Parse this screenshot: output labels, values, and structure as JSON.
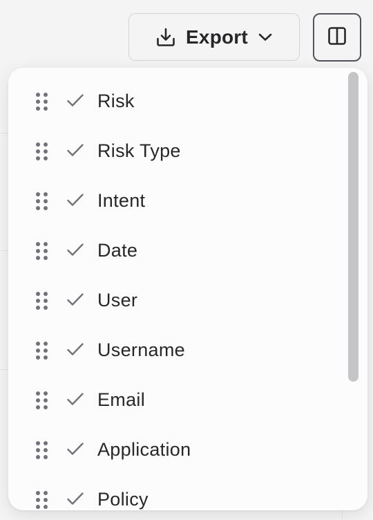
{
  "toolbar": {
    "export_label": "Export",
    "export_icon": "download-icon",
    "dropdown_icon": "chevron-down-icon",
    "columns_icon": "columns-panel-icon"
  },
  "column_menu": {
    "items": [
      {
        "label": "Risk",
        "checked": true
      },
      {
        "label": "Risk Type",
        "checked": true
      },
      {
        "label": "Intent",
        "checked": true
      },
      {
        "label": "Date",
        "checked": true
      },
      {
        "label": "User",
        "checked": true
      },
      {
        "label": "Username",
        "checked": true
      },
      {
        "label": "Email",
        "checked": true
      },
      {
        "label": "Application",
        "checked": true
      },
      {
        "label": "Policy",
        "checked": true
      }
    ]
  },
  "colors": {
    "text": "#27272a",
    "icon": "#71717a",
    "border": "#d4d4d8",
    "panel_bg": "#fcfcfc",
    "page_bg": "#f4f4f5",
    "scrollbar": "#c5c5c8"
  }
}
